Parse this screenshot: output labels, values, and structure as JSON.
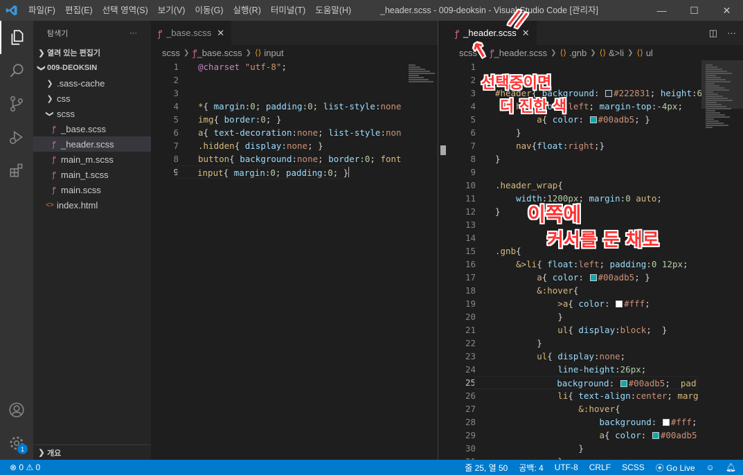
{
  "menu": [
    "파일(F)",
    "편집(E)",
    "선택 영역(S)",
    "보기(V)",
    "이동(G)",
    "실행(R)",
    "터미널(T)",
    "도움말(H)"
  ],
  "window_title": "_header.scss - 009-deoksin - Visual Studio Code [관리자]",
  "sidebar": {
    "title": "탐색기",
    "open_editors": "열려 있는 편집기",
    "project": "009-DEOKSIN",
    "items": [
      {
        "label": ".sass-cache",
        "type": "folder"
      },
      {
        "label": "css",
        "type": "folder"
      },
      {
        "label": "scss",
        "type": "folder-open"
      },
      {
        "label": "_base.scss",
        "type": "sass"
      },
      {
        "label": "_header.scss",
        "type": "sass"
      },
      {
        "label": "main_m.scss",
        "type": "sass"
      },
      {
        "label": "main_t.scss",
        "type": "sass"
      },
      {
        "label": "main.scss",
        "type": "sass"
      },
      {
        "label": "index.html",
        "type": "html"
      }
    ],
    "outline": "개요"
  },
  "left_editor": {
    "tab": "_base.scss",
    "breadcrumb": [
      "scss",
      "_base.scss",
      "input"
    ],
    "lines": [
      "@charset \"utf-8\";",
      "",
      "",
      "*{ margin:0; padding:0; list-style:none",
      "img{ border:0; }",
      "a{ text-decoration:none; list-style:non",
      ".hidden{ display:none; }",
      "button{ background:none; border:0; font",
      "input{ margin:0; padding:0; }"
    ],
    "current_line": 9
  },
  "right_editor": {
    "tab": "_header.scss",
    "breadcrumb": [
      "scss",
      "_header.scss",
      ".gnb",
      "&>li",
      "ul"
    ],
    "start_line": 1,
    "lines": [
      "",
      "",
      "#header{ background: ■#222831; height:6",
      "    h1{ float:left; margin-top:-4px;",
      "        a{ color: ■#00adb5; }",
      "    }",
      "    nav{float:right;}",
      "}",
      "",
      ".header_wrap{",
      "    width:1200px; margin:0 auto;",
      "}",
      "",
      "",
      ".gnb{",
      "    &>li{ float:left; padding:0 12px;",
      "        a{ color: ■#00adb5; }",
      "        &:hover{",
      "            >a{ color: ■#fff;",
      "            }",
      "            ul{ display:block;  }",
      "        }",
      "        ul{ display:none;",
      "            line-height:26px;",
      "            background: ■#00adb5;  pad",
      "            li{ text-align:center; marg",
      "                &:hover{",
      "                    background: ■#fff;",
      "                    a{ color: ■#00adb5",
      "                }",
      "            }"
    ],
    "current_line": 25
  },
  "annotations": {
    "marks": "//",
    "selected_tab_note_1": "선택중이면",
    "selected_tab_note_2": "더 진한 색",
    "cursor_note_1": "이쪽에",
    "cursor_note_2": "커서를 둔 채로"
  },
  "status": {
    "errors": "⊗ 0 ⚠ 0",
    "position": "줄 25, 열 50",
    "spaces": "공백: 4",
    "encoding": "UTF-8",
    "eol": "CRLF",
    "language": "SCSS",
    "golive": "Go Live"
  },
  "colors": {
    "swatch_dark": "#222831",
    "swatch_teal": "#00adb5",
    "swatch_white": "#fff",
    "statusbar": "#007acc"
  }
}
